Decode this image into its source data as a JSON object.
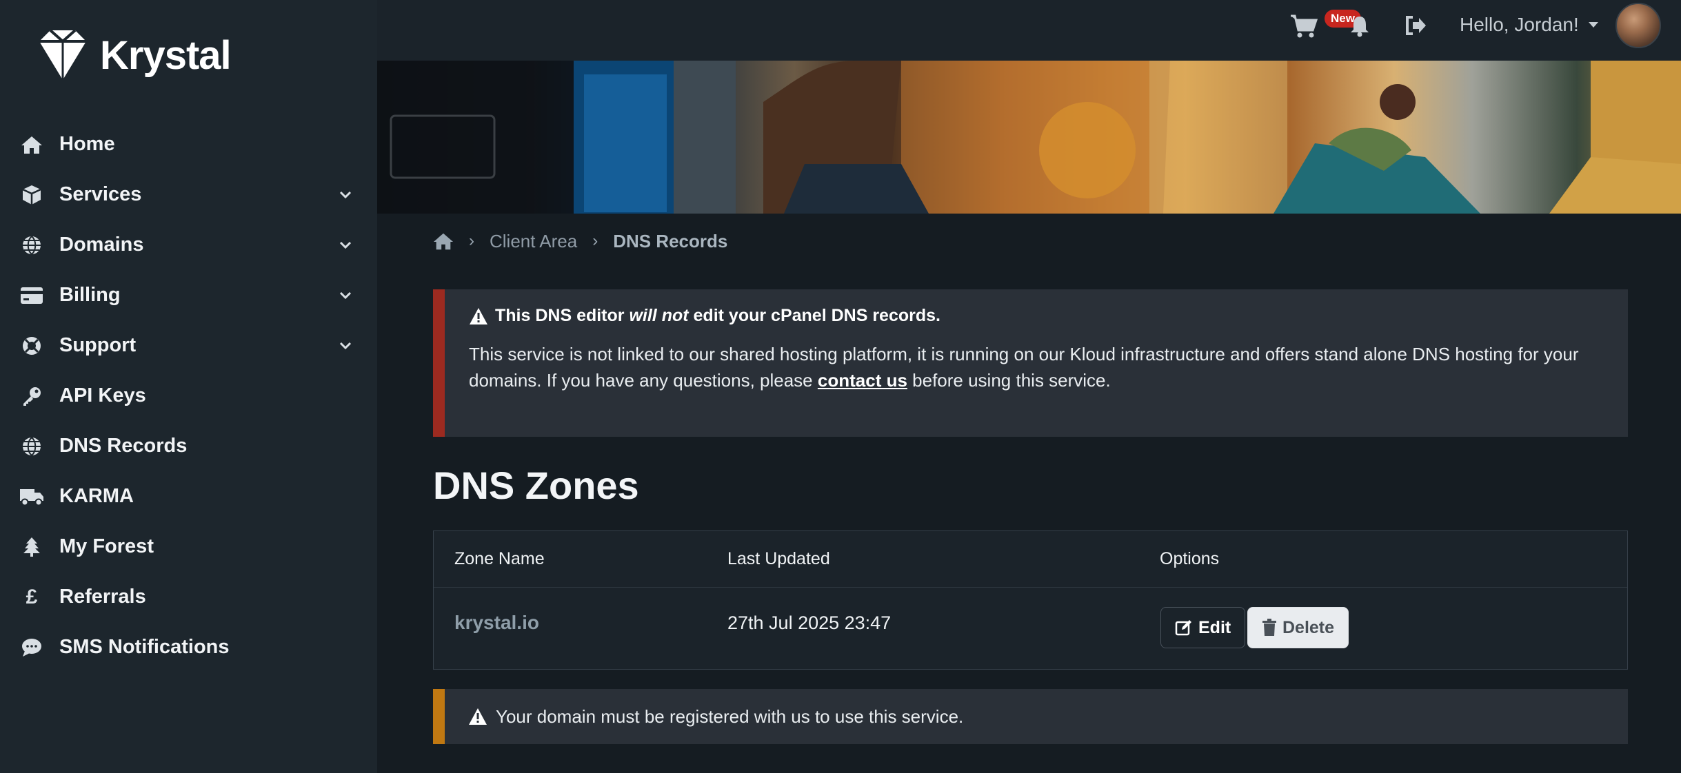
{
  "brand": {
    "name": "Krystal"
  },
  "sidebar": {
    "items": [
      {
        "label": "Home",
        "icon": "home-icon",
        "has_submenu": false
      },
      {
        "label": "Services",
        "icon": "cube-icon",
        "has_submenu": true
      },
      {
        "label": "Domains",
        "icon": "globe-icon",
        "has_submenu": true
      },
      {
        "label": "Billing",
        "icon": "credit-card-icon",
        "has_submenu": true
      },
      {
        "label": "Support",
        "icon": "lifebuoy-icon",
        "has_submenu": true
      },
      {
        "label": "API Keys",
        "icon": "key-icon",
        "has_submenu": false
      },
      {
        "label": "DNS Records",
        "icon": "globe-icon",
        "has_submenu": false
      },
      {
        "label": "KARMA",
        "icon": "truck-icon",
        "has_submenu": false
      },
      {
        "label": "My Forest",
        "icon": "tree-icon",
        "has_submenu": false
      },
      {
        "label": "Referrals",
        "icon": "pound-icon",
        "has_submenu": false
      },
      {
        "label": "SMS Notifications",
        "icon": "sms-bubble-icon",
        "has_submenu": false
      }
    ]
  },
  "topbar": {
    "badge": "New",
    "greeting": "Hello, Jordan!"
  },
  "breadcrumb": {
    "items": [
      "Client Area",
      "DNS Records"
    ]
  },
  "alert_danger": {
    "title_pre": "This DNS editor",
    "title_em": "will not",
    "title_post": "edit your cPanel DNS records.",
    "body_pre": "This service is not linked to our shared hosting platform, it is running on our Kloud infrastructure and offers stand alone DNS hosting for your domains. If you have any questions, please",
    "body_link": "contact us",
    "body_post": "before using this service."
  },
  "page": {
    "title": "DNS Zones"
  },
  "table": {
    "headers": [
      "Zone Name",
      "Last Updated",
      "Options"
    ],
    "rows": [
      {
        "zone": "krystal.io",
        "updated": "27th Jul 2025 23:47"
      }
    ],
    "edit_label": "Edit",
    "delete_label": "Delete"
  },
  "alert_warning": {
    "text": "Your domain must be registered with us to use this service."
  },
  "colors": {
    "sidebar_bg": "#1d262d",
    "page_bg": "#151c22",
    "danger_accent": "#9c2a20",
    "warning_accent": "#c07812",
    "badge_red": "#c8261f"
  }
}
